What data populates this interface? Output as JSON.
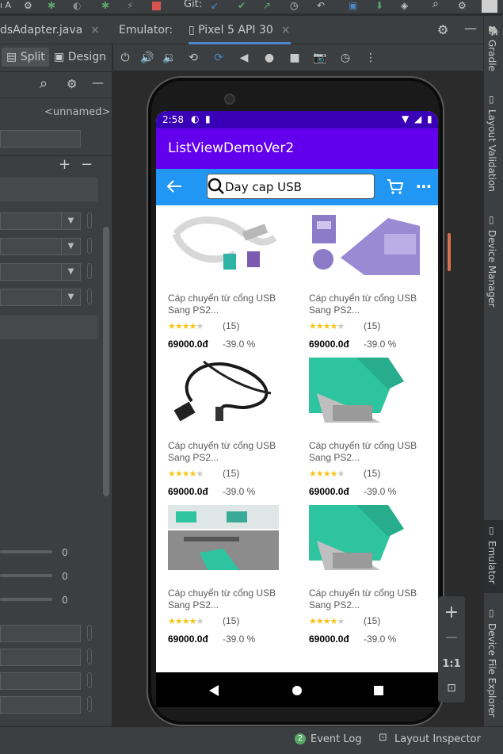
{
  "toolbar": {
    "left_fragment": "ı A",
    "vcs_label": "Git:"
  },
  "tabs": {
    "file_tab": "dsAdapter.java",
    "emulator_label": "Emulator:",
    "device_tab": "Pixel 5 API 30",
    "close": "×"
  },
  "left_panel": {
    "split_label": "Split",
    "design_label": "Design",
    "unnamed": "<unnamed>",
    "plus": "+",
    "minus": "−",
    "slider_values": [
      "0",
      "0",
      "0"
    ]
  },
  "phone": {
    "status_time": "2:58",
    "app_title": "ListViewDemoVer2",
    "search_value": "Day cap USB",
    "products": [
      {
        "name": "Cáp chuyển từ cổng USB Sang PS2...",
        "rating": 4,
        "reviews": "(15)",
        "price": "69000.0đ",
        "discount": "-39.0 %",
        "image": "usb-ps2-cable-white"
      },
      {
        "name": "Cáp chuyển từ cổng USB Sang PS2...",
        "rating": 4,
        "reviews": "(15)",
        "price": "69000.0đ",
        "discount": "-39.0 %",
        "image": "usb-ps2-adapter-purple"
      },
      {
        "name": "Cáp chuyển từ cổng USB Sang PS2...",
        "rating": 4,
        "reviews": "(15)",
        "price": "69000.0đ",
        "discount": "-39.0 %",
        "image": "usb-cable-black"
      },
      {
        "name": "Cáp chuyển từ cổng USB Sang PS2...",
        "rating": 4,
        "reviews": "(15)",
        "price": "69000.0đ",
        "discount": "-39.0 %",
        "image": "usb-adapter-green"
      },
      {
        "name": "Cáp chuyển từ cổng USB Sang PS2...",
        "rating": 4,
        "reviews": "(15)",
        "price": "69000.0đ",
        "discount": "-39.0 %",
        "image": "usb-adapter-green-laptop"
      },
      {
        "name": "Cáp chuyển từ cổng USB Sang PS2...",
        "rating": 4,
        "reviews": "(15)",
        "price": "69000.0đ",
        "discount": "-39.0 %",
        "image": "usb-adapter-green"
      }
    ]
  },
  "zoom": {
    "plus": "+",
    "minus": "−",
    "one_to_one": "1:1"
  },
  "right_strip": {
    "gradle": "Gradle",
    "layout_validation": "Layout Validation",
    "device_manager": "Device Manager",
    "emulator": "Emulator",
    "device_file_explorer": "Device File Explorer"
  },
  "status_bar": {
    "event_badge": "2",
    "event_log": "Event Log",
    "layout_inspector": "Layout Inspector"
  },
  "colors": {
    "app_bar": "#6200ee",
    "status_bar": "#3a00b8",
    "search_bar": "#2196f3",
    "star": "#f5c518"
  }
}
